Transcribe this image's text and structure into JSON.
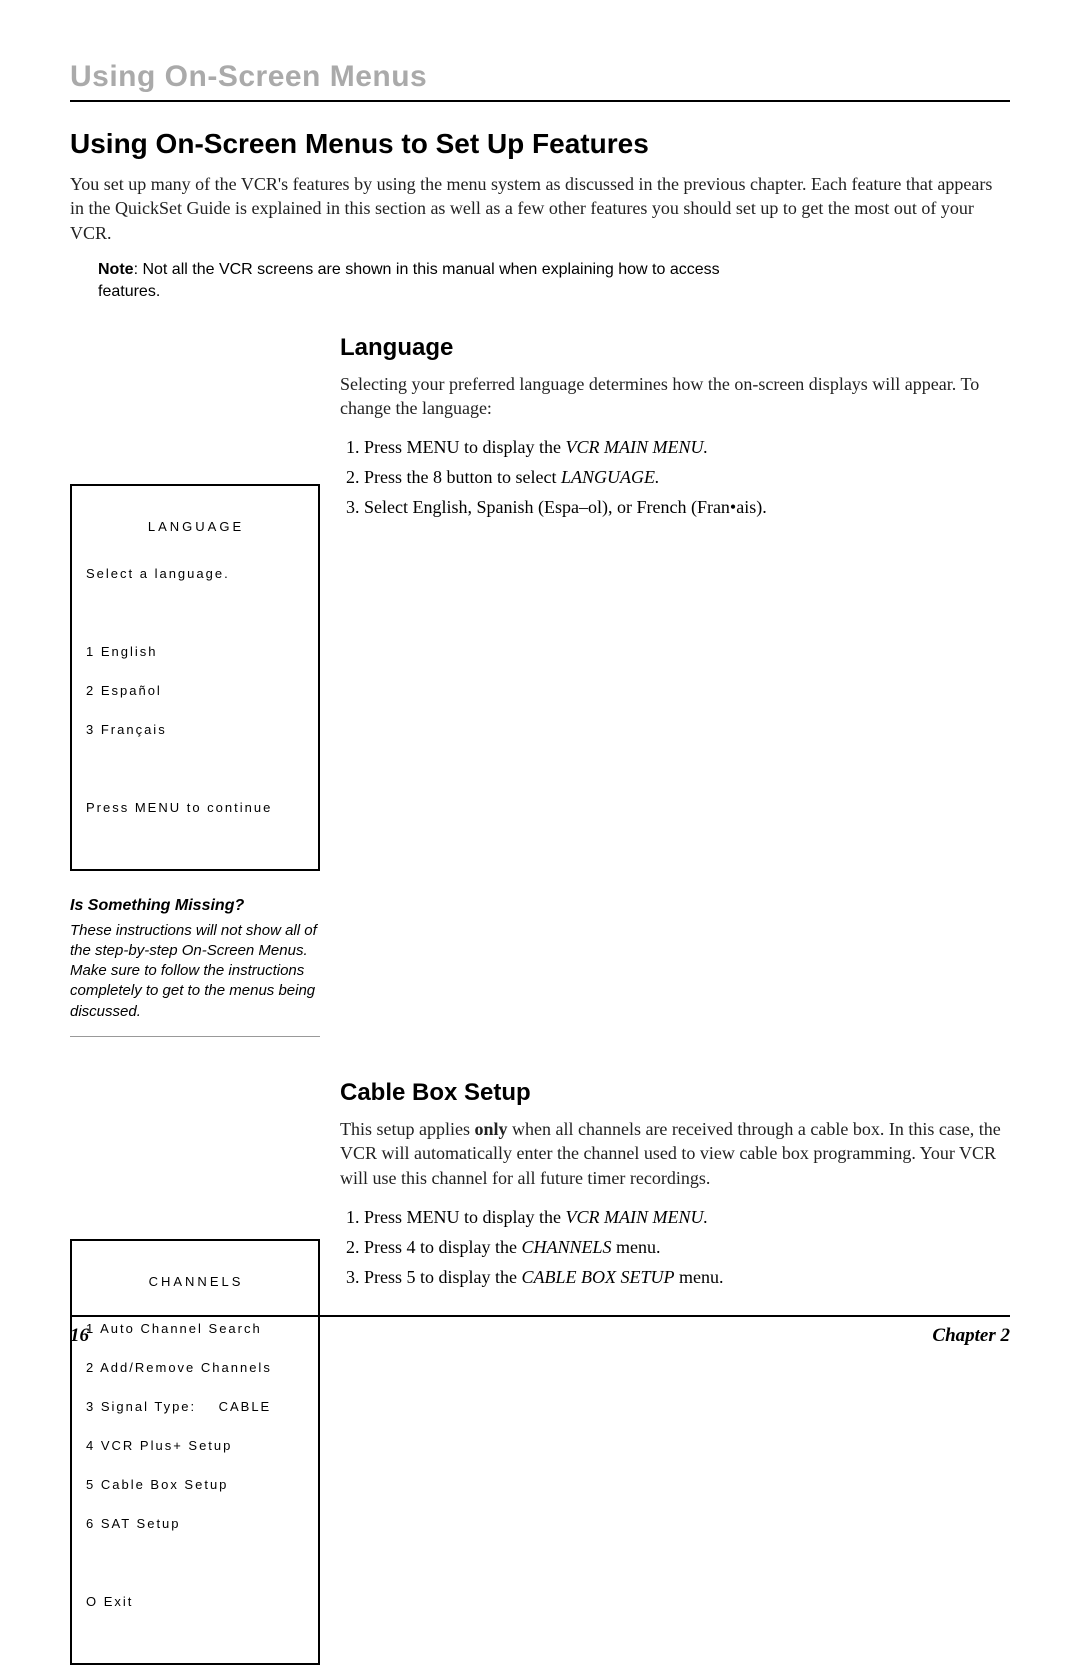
{
  "chapterHeader": "Using On-Screen Menus",
  "sectionTitle": "Using On-Screen Menus to Set Up Features",
  "intro": "You set up many of the VCR's features by using the menu system as discussed in the previous chapter. Each feature that appears in the QuickSet Guide is explained in this section as well as a few other features you should set up to get the most out of your VCR.",
  "noteLabel": "Note",
  "noteBody": ": Not all the VCR screens are shown in this manual when explaining how to access features.",
  "language": {
    "heading": "Language",
    "intro": "Selecting your preferred language determines how the on-screen displays will appear. To change the language:",
    "steps": {
      "s1a": "Press MENU to display the ",
      "s1b": "VCR MAIN MENU.",
      "s2a": "Press the 8 button to select ",
      "s2b": "LANGUAGE.",
      "s3": "Select English, Spanish (Espa–ol), or French (Fran•ais)."
    },
    "screen": {
      "title": "LANGUAGE",
      "prompt": "Select a language.",
      "opt1": "1 English",
      "opt2": "2 Español",
      "opt3": "3 Français",
      "footer": "Press MENU to continue"
    }
  },
  "sideNote": {
    "title": "Is Something Missing?",
    "body": "These instructions will not show all of the step-by-step On-Screen Menus. Make sure to follow the instructions completely to get to the menus being discussed."
  },
  "cable": {
    "heading": "Cable Box Setup",
    "introA": "This setup applies ",
    "introBold": "only",
    "introB": " when all channels are received through a cable box. In this case, the VCR will automatically enter the channel used to view cable box programming. Your VCR will use this channel for all future timer recordings.",
    "steps": {
      "s1a": "Press MENU to display the ",
      "s1b": "VCR MAIN MENU.",
      "s2a": "Press 4 to display the ",
      "s2b": "CHANNELS",
      "s2c": " menu.",
      "s3a": "Press 5 to display the ",
      "s3b": "CABLE BOX SETUP",
      "s3c": " menu."
    },
    "screen": {
      "title": "CHANNELS",
      "l1": "1 Auto Channel Search",
      "l2": "2 Add/Remove Channels",
      "l3": "3 Signal Type:    CABLE",
      "l4": "4 VCR Plus+ Setup",
      "l5": "5 Cable Box Setup",
      "l6": "6 SAT Setup",
      "exit": "O Exit"
    }
  },
  "footer": {
    "page": "16",
    "chapter": "Chapter 2"
  }
}
